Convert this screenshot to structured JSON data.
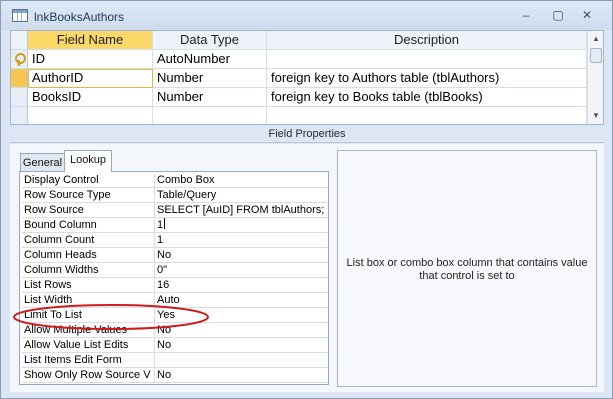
{
  "window": {
    "title": "lnkBooksAuthors",
    "controls": {
      "minimize": "‒",
      "maximize": "▢",
      "close": "✕"
    }
  },
  "grid": {
    "headers": {
      "field_name": "Field Name",
      "data_type": "Data Type",
      "description": "Description"
    },
    "rows": [
      {
        "field_name": "ID",
        "data_type": "AutoNumber",
        "description": "",
        "primary_key": true
      },
      {
        "field_name": "AuthorID",
        "data_type": "Number",
        "description": "foreign key to Authors table (tblAuthors)",
        "selected": true
      },
      {
        "field_name": "BooksID",
        "data_type": "Number",
        "description": "foreign key to Books table (tblBooks)"
      },
      {
        "field_name": "",
        "data_type": "",
        "description": ""
      }
    ]
  },
  "field_properties": {
    "title": "Field Properties",
    "tabs": {
      "general": "General",
      "lookup": "Lookup"
    },
    "active_tab": "Lookup",
    "properties": [
      {
        "label": "Display Control",
        "value": "Combo Box"
      },
      {
        "label": "Row Source Type",
        "value": "Table/Query"
      },
      {
        "label": "Row Source",
        "value": "SELECT [AuID] FROM tblAuthors;"
      },
      {
        "label": "Bound Column",
        "value": "1"
      },
      {
        "label": "Column Count",
        "value": "1"
      },
      {
        "label": "Column Heads",
        "value": "No"
      },
      {
        "label": "Column Widths",
        "value": "0\""
      },
      {
        "label": "List Rows",
        "value": "16"
      },
      {
        "label": "List Width",
        "value": "Auto"
      },
      {
        "label": "Limit To List",
        "value": "Yes",
        "highlighted": true
      },
      {
        "label": "Allow Multiple Values",
        "value": "No"
      },
      {
        "label": "Allow Value List Edits",
        "value": "No"
      },
      {
        "label": "List Items Edit Form",
        "value": ""
      },
      {
        "label": "Show Only Row Source V",
        "value": "No"
      }
    ],
    "help_text": "List box or combo box column that contains value that control is set to"
  },
  "colors": {
    "highlight_ellipse": "#cc1b1b",
    "selected_row": "#f7c650",
    "header_active": "#fbd86a"
  }
}
